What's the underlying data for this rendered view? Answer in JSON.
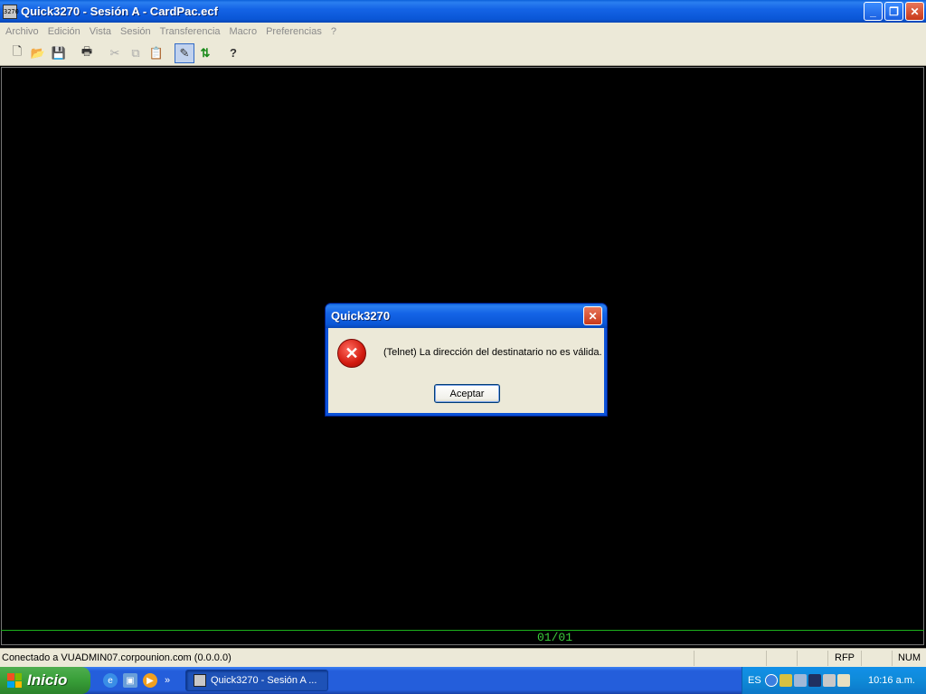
{
  "window": {
    "title": "Quick3270 - Sesión A - CardPac.ecf",
    "app_icon_text": "3270",
    "minimize": "_",
    "restore": "❐",
    "close": "✕"
  },
  "menu": [
    "Archivo",
    "Edición",
    "Vista",
    "Sesión",
    "Transferencia",
    "Macro",
    "Preferencias",
    "?"
  ],
  "toolbar": {
    "new": "🗋",
    "open": "📂",
    "save": "💾",
    "print": "🖶",
    "cut": "✂",
    "copy": "⧉",
    "paste": "📋",
    "connect": "✎",
    "transfer": "⇅",
    "help": "?"
  },
  "terminal": {
    "cursor_position": "01/01"
  },
  "statusbar": {
    "message": "Conectado a VUADMIN07.corpounion.com (0.0.0.0)",
    "rfp": "RFP",
    "num": "NUM"
  },
  "taskbar": {
    "start_label": "Inicio",
    "task_label": "Quick3270 - Sesión A ...",
    "chevron": "»",
    "language": "ES",
    "clock": "10:16 a.m."
  },
  "dialog": {
    "title": "Quick3270",
    "close": "✕",
    "icon": "✕",
    "message": "(Telnet) La dirección del destinatario no es válida.",
    "ok_label": "Aceptar"
  }
}
